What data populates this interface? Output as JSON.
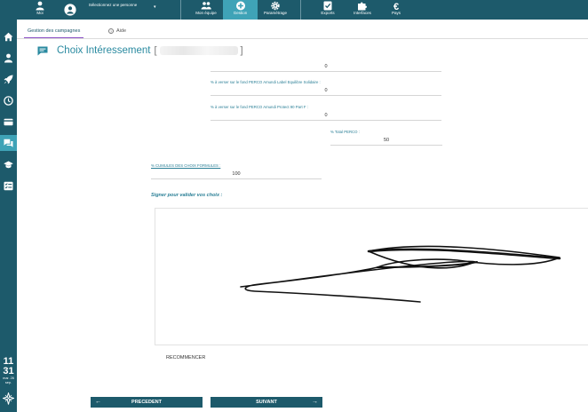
{
  "topbar": {
    "user_label": "Moi",
    "select_person": "Sélectionnez une personne",
    "nav": [
      {
        "label": "Mon équipe",
        "icon": "team-icon"
      },
      {
        "label": "Gestion",
        "icon": "plus-circle-icon",
        "active": true
      },
      {
        "label": "Paramétrage",
        "icon": "gear-icon"
      },
      {
        "label": "Exports",
        "icon": "checkbox-icon"
      },
      {
        "label": "Interfaces",
        "icon": "puzzle-icon"
      },
      {
        "label": "Pays",
        "icon": "euro-icon"
      }
    ]
  },
  "sidebar": {
    "items": [
      "home-icon",
      "person-icon",
      "rocket-icon",
      "clock-icon",
      "card-icon",
      "chat-icon",
      "graduation-cap-icon",
      "checklist-icon"
    ],
    "clock": {
      "hours": "11",
      "minutes": "31",
      "date": "mar. 26 sep."
    },
    "logo": "logo-icon"
  },
  "tabs": {
    "campaigns": "Gestion des campagnes",
    "help": "Aide"
  },
  "page": {
    "title": "Choix Intéressement",
    "bracket_open": "[",
    "bracket_close": "]"
  },
  "fields": {
    "f0_value": "0",
    "f1_label": "% à verser sur le fond PERCO Amundi Label Equilibre Solidaire :",
    "f1_value": "0",
    "f2_label": "% à verser sur le fond PERCO Amundi Protect 90 Part F :",
    "f2_value": "0",
    "total_label": "% Total PERCO :",
    "total_value": "50",
    "cumul_label": "% CUMULES DES CHOIX FORMULES :",
    "cumul_value": "100"
  },
  "signature": {
    "label": "Signer pour valider vos choix :",
    "restart": "RECOMMENCER"
  },
  "buttons": {
    "previous": "PRECEDENT",
    "next": "SUIVANT"
  },
  "colors": {
    "nav_bg": "#1d5a6b",
    "active": "#3fa3b7",
    "accent_text": "#2a8aa0",
    "tab_underline": "#8a4fc4"
  }
}
